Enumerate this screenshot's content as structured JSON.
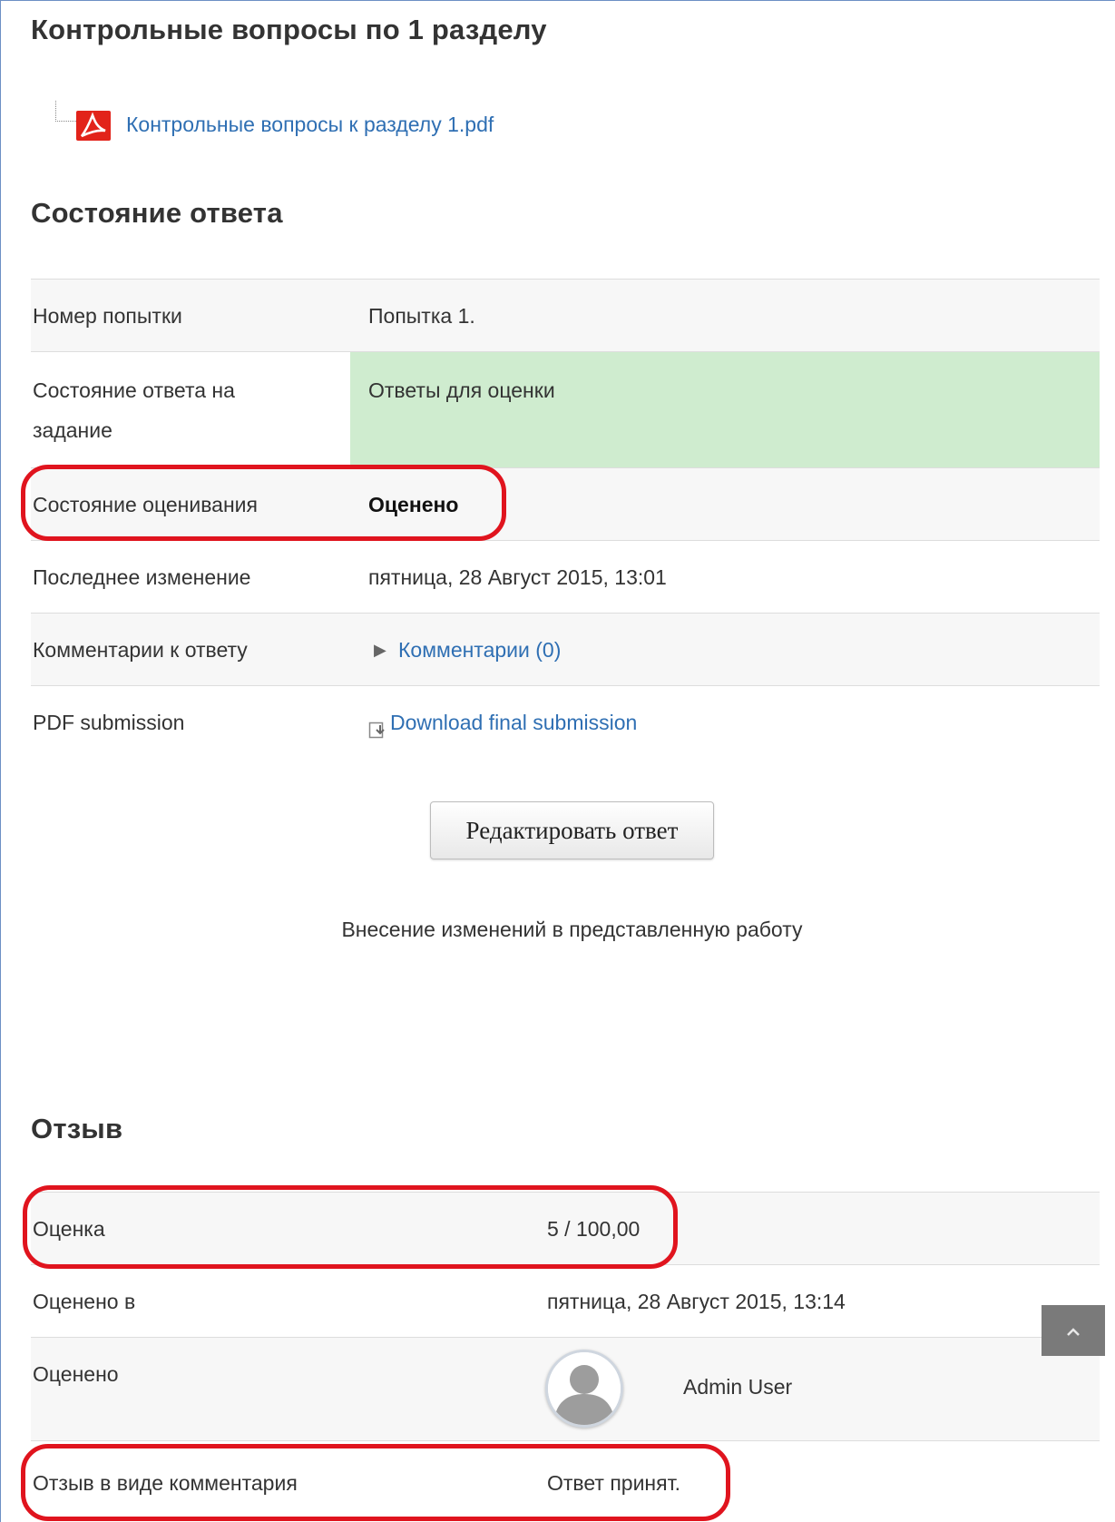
{
  "section_title": "Контрольные вопросы по 1 разделу",
  "file": {
    "icon": "pdf-file-icon",
    "name": "Контрольные вопросы к разделу 1.pdf"
  },
  "submission_status": {
    "heading": "Состояние ответа",
    "rows": [
      {
        "label": "Номер попытки",
        "value": "Попытка 1."
      },
      {
        "label": "Состояние ответа на задание",
        "value": "Ответы для оценки",
        "highlight_color": "#cfeccf"
      },
      {
        "label": "Состояние оценивания",
        "value": "Оценено"
      },
      {
        "label": "Последнее изменение",
        "value": "пятница, 28 Август 2015, 13:01"
      },
      {
        "label": "Комментарии к ответу",
        "value": "Комментарии (0)",
        "icon": "triangle-right-icon"
      },
      {
        "label": "PDF submission",
        "value": "Download final submission",
        "icon": "download-icon"
      }
    ]
  },
  "edit_button": {
    "label": "Редактировать ответ",
    "note": "Внесение изменений в представленную работу"
  },
  "feedback": {
    "heading": "Отзыв",
    "rows": [
      {
        "label": "Оценка",
        "value": "5 / 100,00"
      },
      {
        "label": "Оценено в",
        "value": "пятница, 28 Август 2015, 13:14"
      },
      {
        "label": "Оценено",
        "value": "Admin User",
        "icon": "user-avatar-icon"
      },
      {
        "label": "Отзыв в виде комментария",
        "value": "Ответ принят."
      }
    ]
  },
  "scroll_top": {
    "icon": "chevron-up-icon"
  },
  "colors": {
    "link": "#2f6fb3",
    "annotation": "#e0141e",
    "highlight": "#cfeccf",
    "pdf_icon": "#e2231a"
  }
}
